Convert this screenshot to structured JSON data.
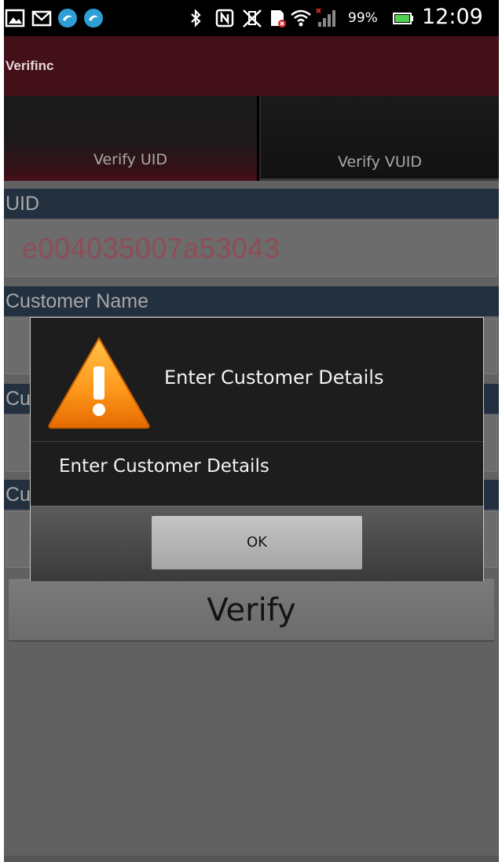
{
  "status_bar": {
    "battery": "99%",
    "time": "12:09",
    "icons": [
      "image-icon",
      "gmail-icon",
      "app-icon",
      "app-icon",
      "bluetooth-icon",
      "nfc-icon",
      "vibrate-off-icon",
      "sim-error-icon",
      "wifi-icon",
      "signal-icon",
      "battery-icon"
    ]
  },
  "app": {
    "title": "Verifinc"
  },
  "tabs": [
    {
      "label": "Verify UID",
      "selected": true
    },
    {
      "label": "Verify VUID",
      "selected": false
    }
  ],
  "form": {
    "uid_label": "UID",
    "uid_value": "e004035007a53043",
    "customer_name_label": "Customer Name",
    "label_3_fragment": "Cu",
    "label_4_fragment": "Cu"
  },
  "verify_button": "Verify",
  "dialog": {
    "title": "Enter Customer Details",
    "message": "Enter Customer Details",
    "ok_label": "OK",
    "icon": "warning-icon"
  },
  "colors": {
    "action_bar": "#431019",
    "label_bar": "#233040",
    "uid_text": "#8f4d56"
  }
}
